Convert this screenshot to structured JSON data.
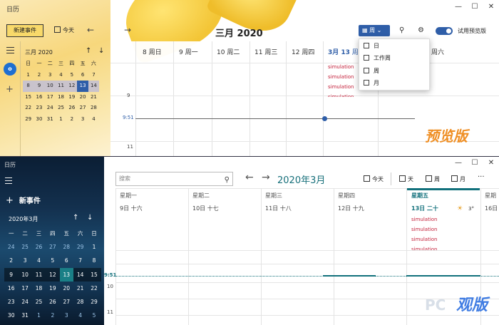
{
  "top": {
    "app_title": "日历",
    "new_event": "新建事件",
    "today": "今天",
    "prev": "←",
    "next": "→",
    "month_title": "三月 2020",
    "view_selector": "周",
    "preview_toggle_label": "试用预览版",
    "mini_calendar": {
      "title": "三月 2020",
      "weekdays": [
        "日",
        "一",
        "二",
        "三",
        "四",
        "五",
        "六"
      ],
      "rows": [
        [
          "1",
          "2",
          "3",
          "4",
          "5",
          "6",
          "7"
        ],
        [
          "8",
          "9",
          "10",
          "11",
          "12",
          "13",
          "14"
        ],
        [
          "15",
          "16",
          "17",
          "18",
          "19",
          "20",
          "21"
        ],
        [
          "22",
          "23",
          "24",
          "25",
          "26",
          "27",
          "28"
        ],
        [
          "29",
          "30",
          "31",
          "1",
          "2",
          "3",
          "4"
        ]
      ],
      "selected": "13"
    },
    "day_headers": [
      {
        "num": "8",
        "wd": "周日"
      },
      {
        "num": "9",
        "wd": "周一"
      },
      {
        "num": "10",
        "wd": "周二"
      },
      {
        "num": "11",
        "wd": "周三"
      },
      {
        "num": "12",
        "wd": "周四"
      },
      {
        "num": "3月 13",
        "wd": "周"
      },
      {
        "num": "",
        "wd": "周六"
      }
    ],
    "events": [
      "simulation",
      "simulation",
      "simulation",
      "simulation"
    ],
    "hours": [
      "9",
      "11"
    ],
    "now_label": "9:51",
    "dropdown": [
      "日",
      "工作周",
      "周",
      "月"
    ],
    "preview_tag": "预览版"
  },
  "bottom": {
    "app_title": "日历",
    "new_event": "新事件",
    "mini_calendar": {
      "title": "2020年3月",
      "weekdays": [
        "一",
        "二",
        "三",
        "四",
        "五",
        "六",
        "日"
      ],
      "rows": [
        [
          "24",
          "25",
          "26",
          "27",
          "28",
          "29",
          "1"
        ],
        [
          "2",
          "3",
          "4",
          "5",
          "6",
          "7",
          "8"
        ],
        [
          "9",
          "10",
          "11",
          "12",
          "13",
          "14",
          "15"
        ],
        [
          "16",
          "17",
          "18",
          "19",
          "20",
          "21",
          "22"
        ],
        [
          "23",
          "24",
          "25",
          "26",
          "27",
          "28",
          "29"
        ],
        [
          "30",
          "31",
          "1",
          "2",
          "3",
          "4",
          "5"
        ]
      ]
    },
    "search_placeholder": "搜索",
    "month_title": "2020年3月",
    "today": "今天",
    "view_day": "天",
    "view_week": "周",
    "view_month": "月",
    "more": "···",
    "weekdays": [
      "星期一",
      "星期二",
      "星期三",
      "星期四",
      "星期五",
      "星期"
    ],
    "days": [
      "9日 十六",
      "10日 十七",
      "11日 十八",
      "12日 十九",
      "13日 二十",
      "16日"
    ],
    "events": [
      "simulation",
      "simulation",
      "simulation",
      "simulation"
    ],
    "weather_temp": "3°",
    "hours": [
      "10",
      "11"
    ],
    "now_label": "9:51",
    "watermark": "观版"
  }
}
